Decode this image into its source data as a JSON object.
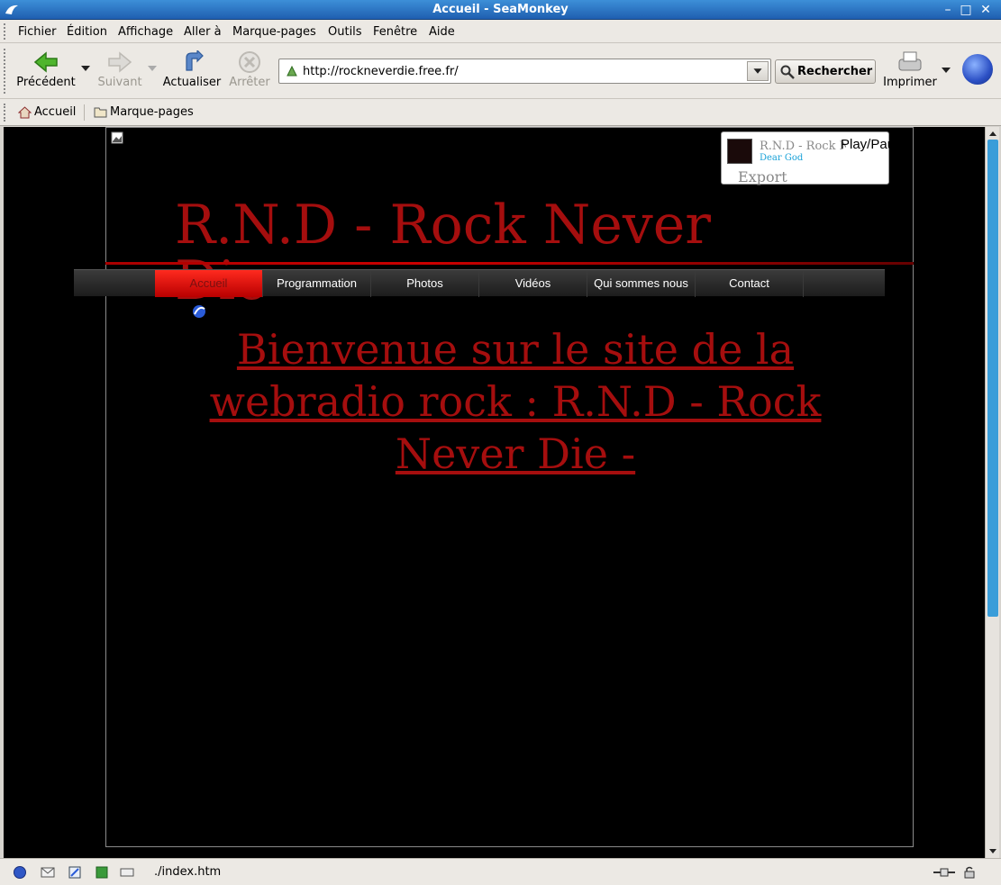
{
  "window": {
    "title": "Accueil - SeaMonkey"
  },
  "menu": [
    "Fichier",
    "Édition",
    "Affichage",
    "Aller à",
    "Marque-pages",
    "Outils",
    "Fenêtre",
    "Aide"
  ],
  "toolbar": {
    "back_label": "Précédent",
    "forward_label": "Suivant",
    "reload_label": "Actualiser",
    "stop_label": "Arrêter",
    "url": "http://rockneverdie.free.fr/",
    "search_label": "Rechercher",
    "print_label": "Imprimer"
  },
  "personal": {
    "home": "Accueil",
    "bookmarks": "Marque-pages"
  },
  "page": {
    "site_title": "R.N.D - Rock Never Die -",
    "nav": [
      "Accueil",
      "Programmation",
      "Photos",
      "Vidéos",
      "Qui sommes nous",
      "Contact"
    ],
    "welcome": "Bienvenue sur le site de la webradio rock : R.N.D - Rock Never Die -",
    "player": {
      "station": "R.N.D - Rock Never Die",
      "song": "Dear God",
      "playpause": "Play/Pause",
      "export": "Export"
    }
  },
  "status": {
    "text": "./index.htm"
  },
  "colors": {
    "brand_red": "#a50e0e",
    "titlebar": "#2d73c4",
    "active_nav": "#e0100a"
  },
  "icons": [
    "seamonkey-icon",
    "back-arrow-icon",
    "forward-arrow-icon",
    "reload-icon",
    "stop-icon",
    "magnifier-icon",
    "printer-icon",
    "home-icon",
    "folder-icon"
  ]
}
